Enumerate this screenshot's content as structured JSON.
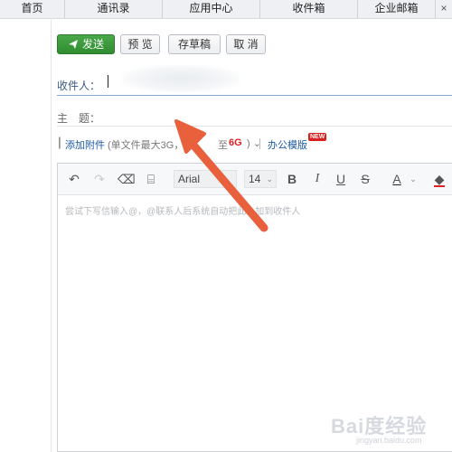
{
  "nav": {
    "tabs": [
      "首页",
      "通讯录",
      "应用中心",
      "收件箱",
      "企业邮箱"
    ],
    "close_glyph": "×"
  },
  "actions": {
    "send": "发送",
    "preview": "预 览",
    "save_draft": "存草稿",
    "cancel": "取 消"
  },
  "fields": {
    "recipient_label": "收件人：",
    "subject_label": "主　题："
  },
  "attach": {
    "add_attachment": "添加附件",
    "note_prefix": "(单文件最大3G，",
    "note_2": "至",
    "note_6g": "6G",
    "note_suffix": ")",
    "templates": "办公模版",
    "new_badge": "NEW"
  },
  "editor": {
    "font": "Arial",
    "font_size": "14",
    "placeholder": "尝试下写信输入@，@联系人后系统自动把此人加到收件人"
  },
  "colors": {
    "send_button": "#3a9a3b",
    "link": "#1e5aa8",
    "highlight": "#d22222",
    "arrow": "#e8603c"
  },
  "watermark": {
    "logo": "Bai度经验",
    "url": "jingyan.baidu.com"
  }
}
